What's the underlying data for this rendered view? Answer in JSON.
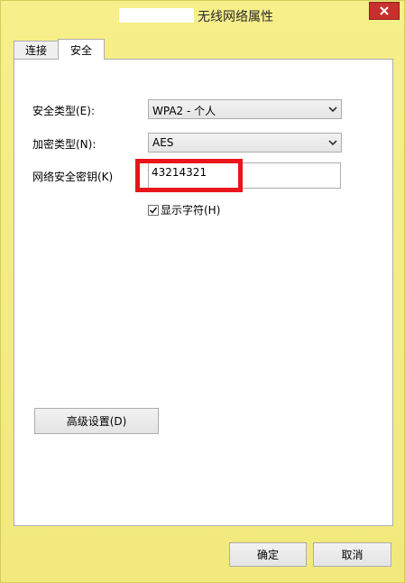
{
  "window": {
    "title": "无线网络属性",
    "close_glyph": "✕"
  },
  "tabs": [
    {
      "label": "连接",
      "active": false
    },
    {
      "label": "安全",
      "active": true
    }
  ],
  "security": {
    "type_label": "安全类型(E):",
    "type_value": "WPA2 - 个人",
    "encryption_label": "加密类型(N):",
    "encryption_value": "AES",
    "key_label": "网络安全密钥(K)",
    "key_value": "43214321",
    "show_chars_label": "显示字符(H)",
    "show_chars_checked": true,
    "advanced_button": "高级设置(D)"
  },
  "footer": {
    "ok_label": "确定",
    "cancel_label": "取消"
  },
  "colors": {
    "frame": "#f4ee84",
    "close_button": "#c7302c",
    "highlight_box": "#e8151b"
  }
}
